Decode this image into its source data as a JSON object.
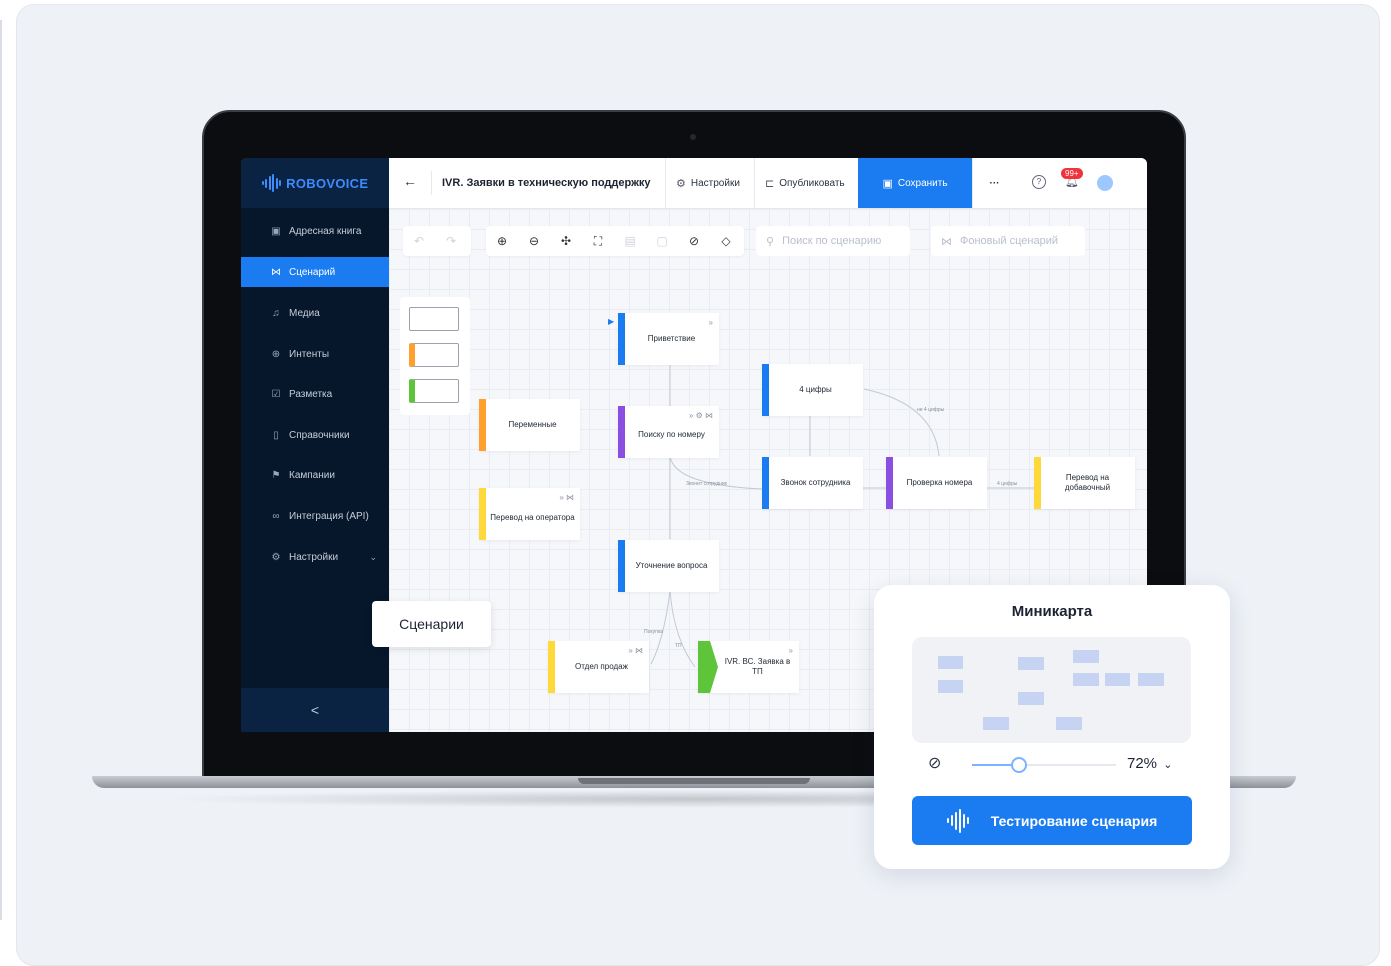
{
  "app": {
    "logo_text": "ROBOVOICE",
    "brand_color": "#1a7cf0",
    "sidebar_color": "#07172b"
  },
  "sidebar": {
    "items": [
      {
        "label": "Адресная книга",
        "icon": "address-book-icon"
      },
      {
        "label": "Сценарий",
        "icon": "scenario-icon",
        "active": true
      },
      {
        "label": "Медиа",
        "icon": "music-note-icon"
      },
      {
        "label": "Интенты",
        "icon": "target-icon"
      },
      {
        "label": "Разметка",
        "icon": "checkbox-icon"
      },
      {
        "label": "Справочники",
        "icon": "book-icon"
      },
      {
        "label": "Кампании",
        "icon": "flag-icon"
      },
      {
        "label": "Интеграция (API)",
        "icon": "integration-icon"
      },
      {
        "label": "Настройки",
        "icon": "gear-icon"
      }
    ],
    "collapse_label": "<"
  },
  "header": {
    "back_label": "←",
    "title": "IVR. Заявки в техническую поддержку",
    "settings_label": "Настройки",
    "publish_label": "Опубликовать",
    "save_label": "Сохранить",
    "more_label": "···",
    "notifications_badge": "99+"
  },
  "toolbar": {
    "search_placeholder": "Поиск по сценарию",
    "background_scenario_label": "Фоновый сценарий"
  },
  "nodes": [
    {
      "label": "Приветствие",
      "color": "#1a7cf0"
    },
    {
      "label": "4 цифры",
      "color": "#1a7cf0"
    },
    {
      "label": "Переменные",
      "color": "#ff9f2e"
    },
    {
      "label": "Поиску по номеру",
      "color": "#8a4fe0"
    },
    {
      "label": "Звонок сотрудника",
      "color": "#1a7cf0"
    },
    {
      "label": "Проверка номера",
      "color": "#8a4fe0"
    },
    {
      "label": "Перевод на добавочный",
      "color": "#ffd83a"
    },
    {
      "label": "Перевод на оператора",
      "color": "#ffd83a"
    },
    {
      "label": "Уточнение вопроса",
      "color": "#1a7cf0"
    },
    {
      "label": "Отдел продаж",
      "color": "#ffd83a"
    },
    {
      "label": "IVR. ВС. Заявка в ТП",
      "color": "#5ec43a"
    }
  ],
  "edge_labels": {
    "not_4_digits": "не 4 цифры",
    "call_employee": "Звонит сотрудник",
    "four_digits": "4 цифры",
    "purchase": "Покупка",
    "tp": "ТП"
  },
  "tooltip": {
    "label": "Сценарии"
  },
  "minimap": {
    "title": "Миникарта",
    "zoom_label": "72%",
    "zoom_value": 0.72,
    "slider_level": 0.32,
    "test_button_label": "Тестирование сценария"
  }
}
